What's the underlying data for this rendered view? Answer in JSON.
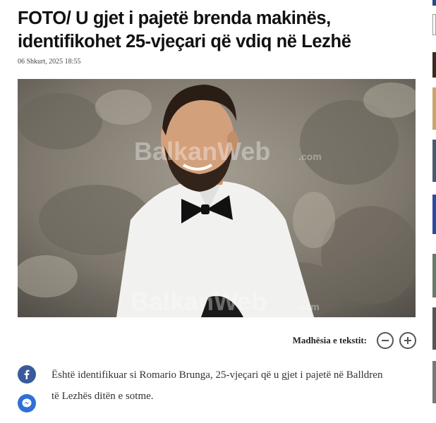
{
  "article": {
    "headline": "FOTO/ U gjet i pajetë brenda makinës, identifikohet 25-vjeçari që vdiq në Lezhë",
    "date": "06 Shkurt, 2025 18:55",
    "image": {
      "watermark": "BalkanWeb",
      "watermark_suffix": ".com"
    },
    "font_tools": {
      "label": "Madhësia e tekstit:",
      "decrease_icon": "minus-icon",
      "increase_icon": "plus-icon"
    },
    "share": {
      "facebook_icon": "facebook-icon",
      "messenger_icon": "messenger-icon"
    },
    "body": "Është identifikuar si Romario Brunga, 25-vjeçari që u gjet i pajetë në Balldren të Lezhës ditën e sotme."
  },
  "colors": {
    "facebook": "#3a5a9b",
    "messenger": "#2f6fd6"
  }
}
